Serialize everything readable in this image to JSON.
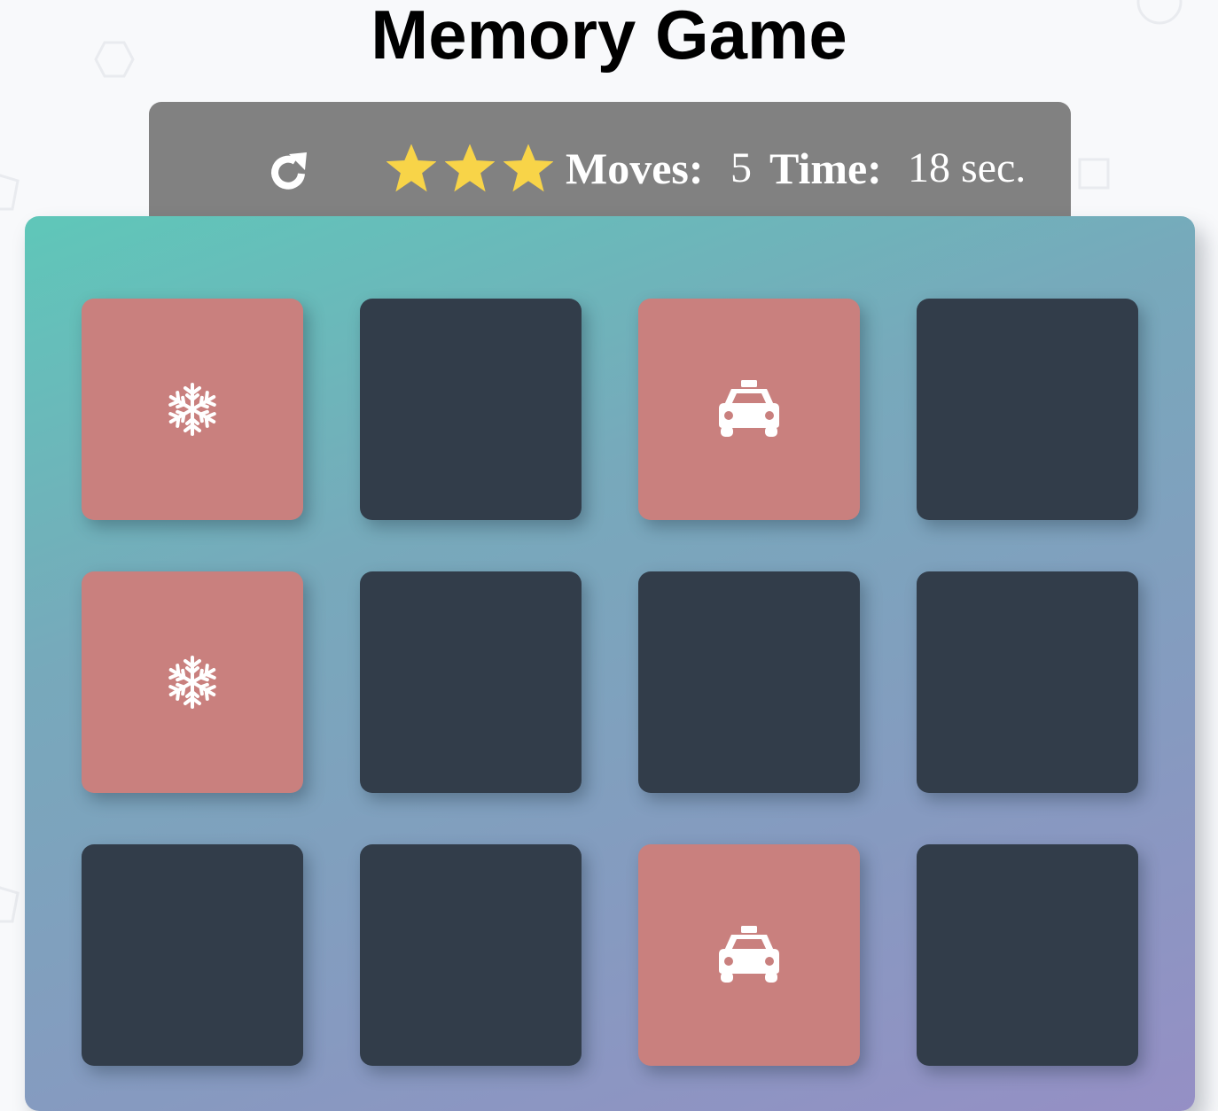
{
  "title": "Memory Game",
  "score_panel": {
    "restart_icon": "rotate-right-icon",
    "stars": {
      "filled": 3,
      "total": 3,
      "color": "#f8d448"
    },
    "moves_label": "Moves:",
    "moves_value": "5",
    "time_label": "Time:",
    "time_value": "18 sec."
  },
  "colors": {
    "panel": "#818181",
    "card_closed": "#323d4a",
    "card_open": "#c9807e",
    "deck_gradient": [
      "#5fc7b9",
      "#958fc5"
    ]
  },
  "deck": {
    "columns": 4,
    "rows": 3,
    "cards": [
      {
        "state": "open",
        "icon": "snowflake-icon"
      },
      {
        "state": "closed",
        "icon": ""
      },
      {
        "state": "open",
        "icon": "taxi-icon"
      },
      {
        "state": "closed",
        "icon": ""
      },
      {
        "state": "open",
        "icon": "snowflake-icon"
      },
      {
        "state": "closed",
        "icon": ""
      },
      {
        "state": "closed",
        "icon": ""
      },
      {
        "state": "closed",
        "icon": ""
      },
      {
        "state": "closed",
        "icon": ""
      },
      {
        "state": "closed",
        "icon": ""
      },
      {
        "state": "open",
        "icon": "taxi-icon"
      },
      {
        "state": "closed",
        "icon": ""
      }
    ]
  }
}
